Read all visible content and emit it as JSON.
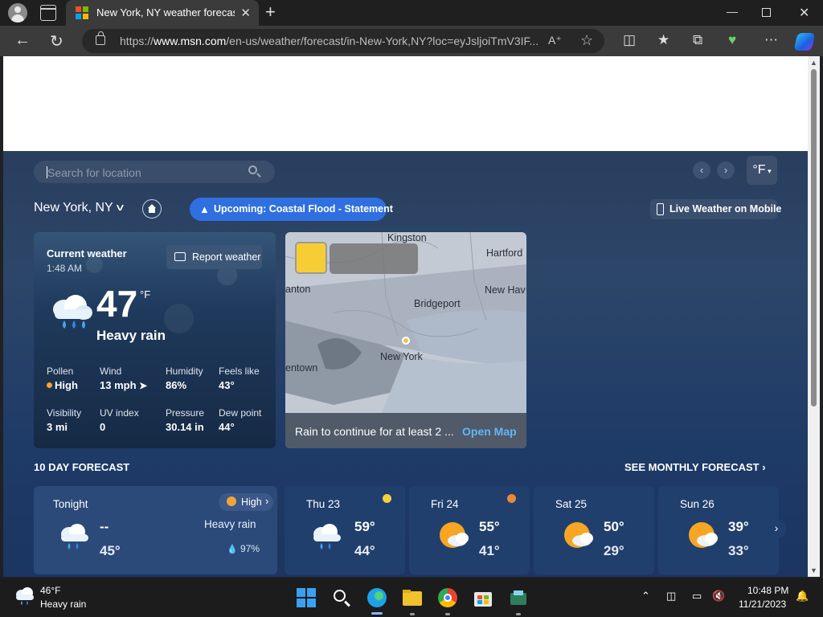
{
  "browser": {
    "tab_title": "New York, NY weather forecast |",
    "url_host": "www.msn.com",
    "url_prefix": "https://",
    "url_rest": "/en-us/weather/forecast/in-New-York,NY?loc=eyJsljoiTmV3IF...",
    "new_tab_label": "+",
    "tab_close_label": "✕"
  },
  "weather": {
    "search_placeholder": "Search for location",
    "unit_toggle": "°F",
    "location": "New York, NY",
    "alert": "Upcoming: Coastal Flood - Statement",
    "mobile_button": "Live Weather on Mobile",
    "current": {
      "title": "Current weather",
      "time": "1:48 AM",
      "report_button": "Report weather",
      "temp": "47",
      "unit": "°F",
      "condition": "Heavy rain",
      "icon": "rain-cloud-icon",
      "stats": [
        {
          "label": "Pollen",
          "value": "High"
        },
        {
          "label": "Wind",
          "value": "13 mph"
        },
        {
          "label": "Humidity",
          "value": "86%"
        },
        {
          "label": "Feels like",
          "value": "43°"
        },
        {
          "label": "Visibility",
          "value": "3 mi"
        },
        {
          "label": "UV index",
          "value": "0"
        },
        {
          "label": "Pressure",
          "value": "30.14 in"
        },
        {
          "label": "Dew point",
          "value": "44°"
        }
      ]
    },
    "map": {
      "labels": {
        "kingston": "Kingston",
        "hartford": "Hartford",
        "anton": "anton",
        "new_hav": "New Hav",
        "bridgeport": "Bridgeport",
        "new_york": "New York",
        "entown": "entown"
      },
      "footer_text": "Rain to continue for at least 2 ...",
      "open_map": "Open Map"
    },
    "forecast_title": "10 DAY FORECAST",
    "monthly_link": "SEE MONTHLY FORECAST",
    "forecast": [
      {
        "day": "Tonight",
        "hi": "--",
        "lo": "45°",
        "condition": "Heavy rain",
        "precip": "97%",
        "badge": "High",
        "icon": "rain-cloud-icon"
      },
      {
        "day": "Thu 23",
        "hi": "59°",
        "lo": "44°",
        "icon": "rain-cloud-icon"
      },
      {
        "day": "Fri 24",
        "hi": "55°",
        "lo": "41°",
        "icon": "partly-sunny-icon"
      },
      {
        "day": "Sat 25",
        "hi": "50°",
        "lo": "29°",
        "icon": "partly-sunny-icon"
      },
      {
        "day": "Sun 26",
        "hi": "39°",
        "lo": "33°",
        "icon": "partly-sunny-icon"
      }
    ],
    "colors": {
      "accent": "#2f6fe0",
      "link": "#64b5f6",
      "pollen": "#f0a53a",
      "alert_swatch": "#f7cd35"
    }
  },
  "taskbar": {
    "weather_temp": "46°F",
    "weather_cond": "Heavy rain",
    "time": "10:48 PM",
    "date": "11/21/2023"
  }
}
